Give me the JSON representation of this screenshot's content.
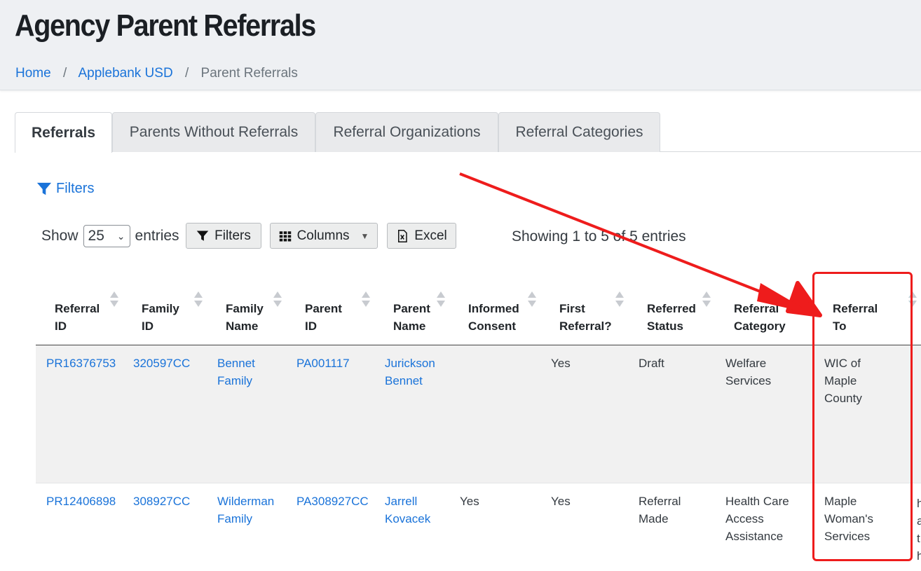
{
  "page": {
    "title": "Agency Parent Referrals"
  },
  "breadcrumb": {
    "items": [
      "Home",
      "Applebank USD"
    ],
    "current": "Parent Referrals"
  },
  "tabs": [
    "Referrals",
    "Parents Without Referrals",
    "Referral Organizations",
    "Referral Categories"
  ],
  "active_tab": "Referrals",
  "filters_link": "Filters",
  "controls": {
    "show_label": "Show",
    "entries_value": "25",
    "entries_label": "entries",
    "filters_button": "Filters",
    "columns_button": "Columns",
    "excel_button": "Excel",
    "info": "Showing 1 to 5 of 5 entries"
  },
  "table": {
    "headers": [
      {
        "l1": "Referral",
        "l2": "ID"
      },
      {
        "l1": "Family",
        "l2": "ID"
      },
      {
        "l1": "Family",
        "l2": "Name"
      },
      {
        "l1": "Parent",
        "l2": "ID"
      },
      {
        "l1": "Parent",
        "l2": "Name"
      },
      {
        "l1": "Informed",
        "l2": "Consent"
      },
      {
        "l1": "First",
        "l2": "Referral?"
      },
      {
        "l1": "Referred",
        "l2": "Status"
      },
      {
        "l1": "Referral",
        "l2": "Category"
      },
      {
        "l1": "Referral",
        "l2": "To"
      }
    ],
    "rows": [
      {
        "referral_id": "PR16376753",
        "family_id": "320597CC",
        "family_name": "Bennet Family",
        "parent_id": "PA001117",
        "parent_name": "Jurickson Bennet",
        "informed_consent": "",
        "first_referral": "Yes",
        "status": "Draft",
        "category": "Welfare Services",
        "referral_to": "WIC of Maple County"
      },
      {
        "referral_id": "PR12406898",
        "family_id": "308927CC",
        "family_name": "Wilderman Family",
        "parent_id": "PA308927CC",
        "parent_name": "Jarrell Kovacek",
        "informed_consent": "Yes",
        "first_referral": "Yes",
        "status": "Referral Made",
        "category": "Health Care Access Assistance",
        "referral_to": "Maple Woman's Services"
      }
    ],
    "overflow_column_fragments": [
      "h",
      "a",
      "t",
      "h"
    ]
  },
  "annotation": {
    "color": "#ee1c1c"
  },
  "colors": {
    "link": "#1a73d9",
    "header_bg": "#eef0f3",
    "odd_row_bg": "#f1f1f1"
  }
}
